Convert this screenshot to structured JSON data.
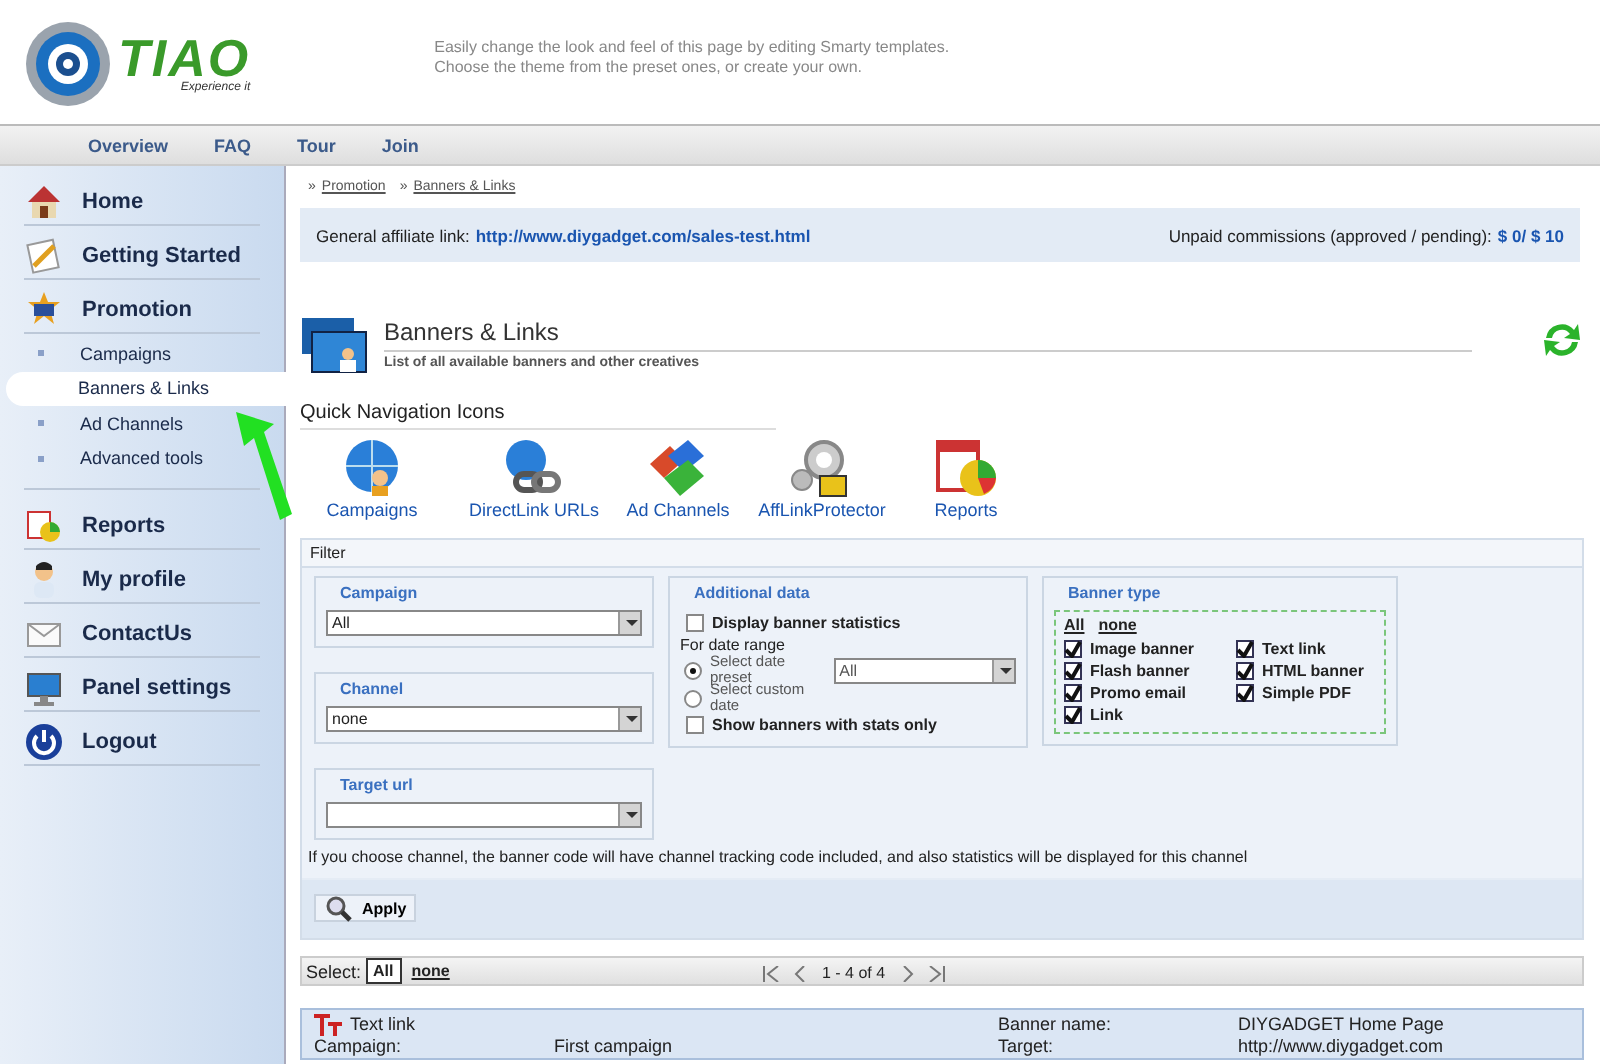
{
  "header": {
    "logo_text": "TIAO",
    "logo_tagline": "Experience it",
    "tagline": [
      "Easily change the look and feel of this page by editing Smarty templates.",
      "Choose the theme from the preset ones, or create your own."
    ]
  },
  "nav": [
    {
      "label": "Overview"
    },
    {
      "label": "FAQ"
    },
    {
      "label": "Tour"
    },
    {
      "label": "Join"
    }
  ],
  "sidebar": {
    "items": [
      {
        "label": "Home",
        "kind": "home"
      },
      {
        "label": "Getting Started",
        "kind": "start"
      },
      {
        "label": "Promotion",
        "kind": "promotion",
        "children": [
          {
            "label": "Campaigns",
            "selected": false
          },
          {
            "label": "Banners & Links",
            "selected": true
          },
          {
            "label": "Ad Channels",
            "selected": false
          },
          {
            "label": "Advanced tools",
            "selected": false
          }
        ]
      },
      {
        "label": "Reports",
        "kind": "reports"
      },
      {
        "label": "My profile",
        "kind": "profile"
      },
      {
        "label": "ContactUs",
        "kind": "contact"
      },
      {
        "label": "Panel settings",
        "kind": "settings"
      },
      {
        "label": "Logout",
        "kind": "logout"
      }
    ]
  },
  "breadcrumb": [
    {
      "sep": "»",
      "label": "Promotion"
    },
    {
      "sep": "»",
      "label": "Banners & Links"
    }
  ],
  "affiliate_bar": {
    "label": "General affiliate link:",
    "link": "http://www.diygadget.com/sales-test.html",
    "commissions_label": "Unpaid commissions (approved / pending):",
    "commissions_value": "$ 0/ $ 10"
  },
  "page_title": "Banners & Links",
  "page_subtitle": "List of all available banners and other creatives",
  "quick_nav": {
    "title": "Quick Navigation Icons",
    "items": [
      {
        "label": "Campaigns",
        "kind": "globe"
      },
      {
        "label": "DirectLink URLs",
        "kind": "link"
      },
      {
        "label": "Ad Channels",
        "kind": "blocks"
      },
      {
        "label": "AffLinkProtector",
        "kind": "gears"
      },
      {
        "label": "Reports",
        "kind": "reports"
      }
    ]
  },
  "filter": {
    "title": "Filter",
    "selects": [
      {
        "legend": "Campaign",
        "value": "All"
      },
      {
        "legend": "Channel",
        "value": "none"
      },
      {
        "legend": "Target url"
      }
    ],
    "additional": {
      "legend": "Additional data",
      "stats": {
        "label": "Display banner statistics",
        "checked": false
      },
      "range_label": "For date range",
      "radios": [
        {
          "label": "Select date preset",
          "selected": true,
          "value": "All"
        },
        {
          "label": "Select custom date",
          "selected": false
        }
      ],
      "with_stats": {
        "label": "Show banners with stats only",
        "checked": false
      }
    },
    "banner_type": {
      "legend": "Banner type",
      "all": "All",
      "none": "none",
      "options": [
        {
          "label": "Image banner",
          "checked": true
        },
        {
          "label": "Text link",
          "checked": true
        },
        {
          "label": "Flash banner",
          "checked": true
        },
        {
          "label": "HTML banner",
          "checked": true
        },
        {
          "label": "Promo email",
          "checked": true
        },
        {
          "label": "Simple PDF",
          "checked": true
        },
        {
          "label": "Link",
          "checked": true
        }
      ]
    },
    "note": "If you choose channel, the banner code will have channel tracking code included, and also statistics will be displayed for this channel",
    "apply": "Apply"
  },
  "list_toolbar": {
    "label": "Select:",
    "options": [
      {
        "label": "All",
        "selected": true
      },
      {
        "label": "none",
        "selected": false
      }
    ],
    "pager": "1 - 4 of 4"
  },
  "list": [
    {
      "type": "Text link",
      "fields": [
        [
          "Banner name:",
          "DIYGADGET Home Page"
        ],
        [
          "Campaign:",
          "First campaign"
        ],
        [
          "Target:",
          "http://www.diygadget.com"
        ]
      ]
    }
  ]
}
